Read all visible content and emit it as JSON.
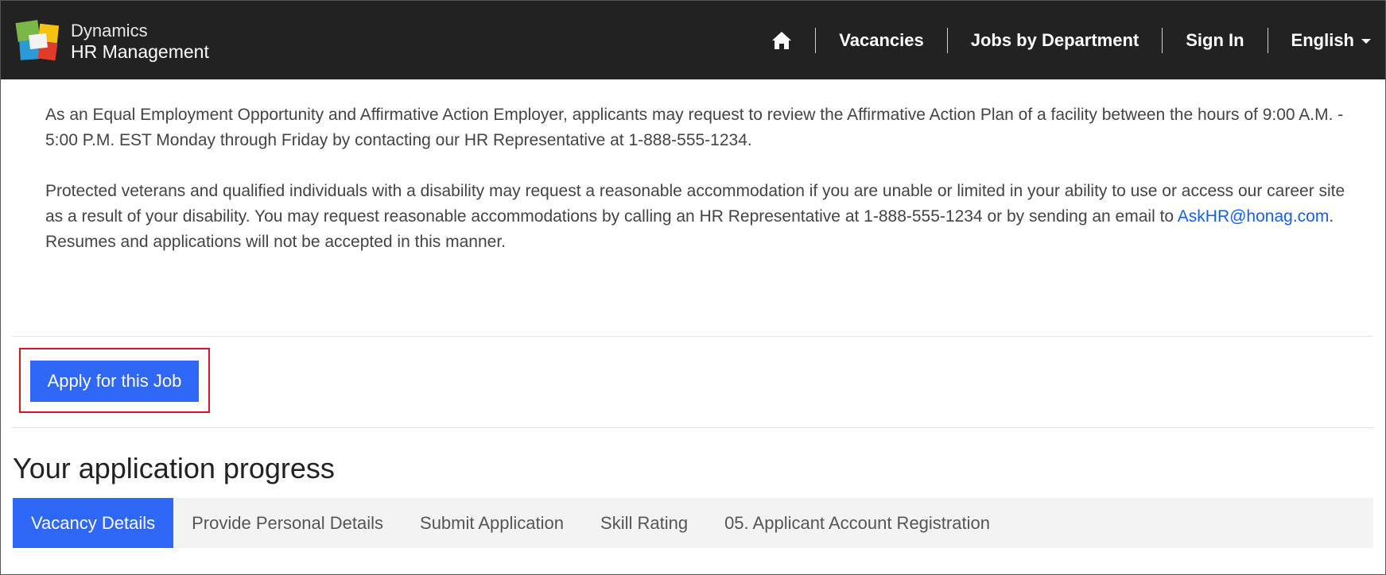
{
  "brand": {
    "line1": "Dynamics",
    "line2": "HR Management"
  },
  "nav": {
    "home_icon": "home-icon",
    "items": [
      "Vacancies",
      "Jobs by Department",
      "Sign In",
      "English"
    ]
  },
  "content": {
    "para1": "As an Equal Employment Opportunity and Affirmative Action Employer, applicants may request to review the Affirmative Action Plan of a facility between the hours of 9:00 A.M. - 5:00 P.M. EST Monday through Friday by contacting our HR Representative at 1-888-555-1234.",
    "para2_before": "Protected veterans and qualified individuals with a disability may request a reasonable accommodation if you are unable or limited in your ability to use or access our career site as a result of your disability. You may request reasonable accommodations by calling an HR Representative at 1-888-555-1234 or by sending an email to ",
    "para2_link": "AskHR@honag.com",
    "para2_after": ". Resumes and applications will not be accepted in this manner."
  },
  "apply": {
    "label": "Apply for this Job"
  },
  "progress": {
    "title": "Your application progress",
    "tabs": [
      "Vacancy Details",
      "Provide Personal Details",
      "Submit Application",
      "Skill Rating",
      "05. Applicant Account Registration"
    ],
    "active_index": 0
  },
  "colors": {
    "header_bg": "#222222",
    "accent": "#2f68f6",
    "highlight": "#e0141e",
    "link": "#1a5fe0"
  }
}
